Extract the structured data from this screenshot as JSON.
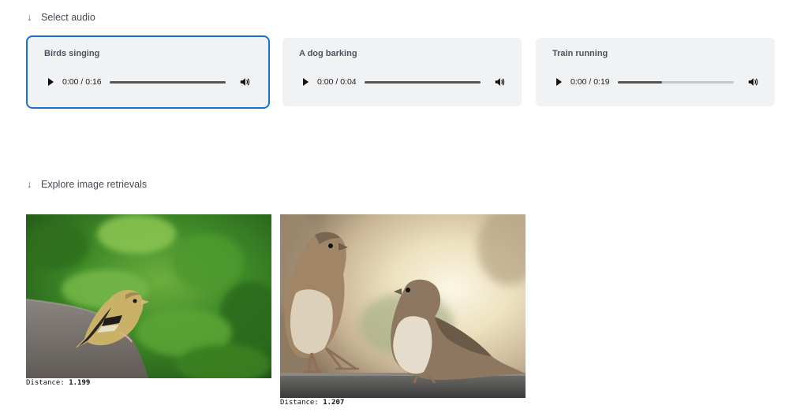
{
  "select_audio": {
    "label": "Select audio",
    "cards": [
      {
        "title": "Birds singing",
        "time": "0:00 / 0:16",
        "progress": 1.0,
        "selected": true
      },
      {
        "title": "A dog barking",
        "time": "0:00 / 0:04",
        "progress": 1.0,
        "selected": false
      },
      {
        "title": "Train running",
        "time": "0:00 / 0:19",
        "progress": 0.38,
        "selected": false
      }
    ]
  },
  "retrievals": {
    "label": "Explore image retrievals",
    "distance_label": "Distance:",
    "results": [
      {
        "distance": "1.199",
        "image": "goldfinch-on-rock-photo"
      },
      {
        "distance": "1.207",
        "image": "two-sparrows-on-ledge-photo"
      }
    ]
  },
  "colors": {
    "selected_border": "#1a6fd1",
    "card_bg": "#f1f2f4"
  },
  "icons": [
    "down-arrow-icon",
    "play-icon",
    "volume-icon"
  ]
}
